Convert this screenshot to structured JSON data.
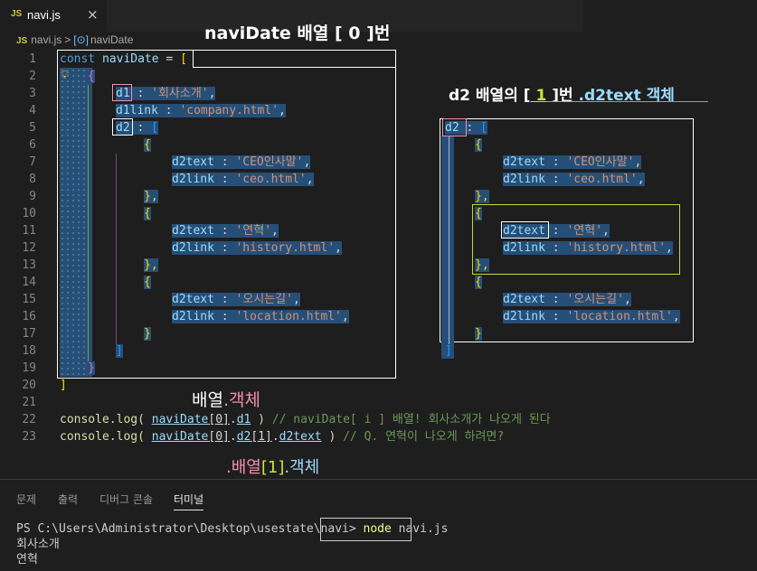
{
  "tab": {
    "icon": "JS",
    "name": "navi.js",
    "close": "×"
  },
  "breadcrumb": {
    "file_icon": "JS",
    "file": "navi.js",
    "sep": ">",
    "symbol_icon": "[⊙]",
    "symbol": "naviDate"
  },
  "line_numbers": [
    "1",
    "2",
    "3",
    "4",
    "5",
    "6",
    "7",
    "8",
    "9",
    "10",
    "11",
    "12",
    "13",
    "14",
    "15",
    "16",
    "17",
    "18",
    "19",
    "20",
    "21",
    "22",
    "23"
  ],
  "code": {
    "l1_kw": "const",
    "l1_var": "naviDate",
    "l1_eq": " = ",
    "l1_br": "[",
    "l2_br": "{",
    "l3_key": "d1",
    "l3_val": "'회사소개'",
    "l4_key": "d1link",
    "l4_val": "'company.html'",
    "l5_key": "d2",
    "l5_br": "[",
    "obj_open": "{",
    "obj_close": "},",
    "obj_last_close": "}",
    "l7_key": "d2text",
    "l7_val": "'CEO인사말'",
    "l8_key": "d2link",
    "l8_val": "'ceo.html'",
    "l11_val": "'연혁'",
    "l12_val": "'history.html'",
    "l15_val": "'오시는길'",
    "l16_val": "'location.html'",
    "l18_br": "]",
    "l19_br": "}",
    "l20_br": "]",
    "colon": " : ",
    "comma": ",",
    "l22_fn": "console.log(",
    "l22_expr_obj": "naviDate",
    "l22_expr_idx": "[0]",
    "l22_expr_dot": ".",
    "l22_expr_prop": "d1",
    "l22_close": " )",
    "l22_comment": " // naviDate[ i ] 배열! 회사소개가 나오게 된다",
    "l23_expr_d2": "d2",
    "l23_expr_idx1": "[1]",
    "l23_expr_prop": "d2text",
    "l23_comment": " // Q. 연혁이 나오게 하려면?"
  },
  "annotations": {
    "title_left": "naviDate 배열 [ 0 ]번",
    "title_right_a": "d2 배열의 [",
    "title_right_num": " 1 ",
    "title_right_b": "]번 ",
    "title_right_c": ".d2text 객체",
    "mid_a": "배열",
    "mid_b": ".객체",
    "bottom_a": ".배열",
    "bottom_b": "[1]",
    "bottom_c": ".객체"
  },
  "right_snippet": {
    "key": "d2",
    "colon": " : ",
    "br": "[",
    "o1_key1": "d2text",
    "o1_val1": "'CEO인사말'",
    "o1_key2": "d2link",
    "o1_val2": "'ceo.html'",
    "o2_val1": "'연혁'",
    "o2_val2": "'history.html'",
    "o3_val1": "'오시는길'",
    "o3_val2": "'location.html'",
    "end": "]"
  },
  "panel": {
    "tabs": [
      "문제",
      "출력",
      "디버그 콘솔",
      "터미널"
    ],
    "prompt": "PS C:\\Users\\Administrator\\Desktop\\usestate\\navi>",
    "cmd": "node",
    "cmd_arg": " navi.js",
    "out1": "회사소개",
    "out2": "연혁"
  },
  "colors": {
    "keyword": "#569cd6",
    "variable": "#9cdcfe",
    "string": "#ce9178",
    "selection": "#264f78",
    "bracket_gold": "#ffd700",
    "bracket_pink": "#da70d6",
    "bracket_blue": "#179fff",
    "comment": "#6a9955"
  }
}
